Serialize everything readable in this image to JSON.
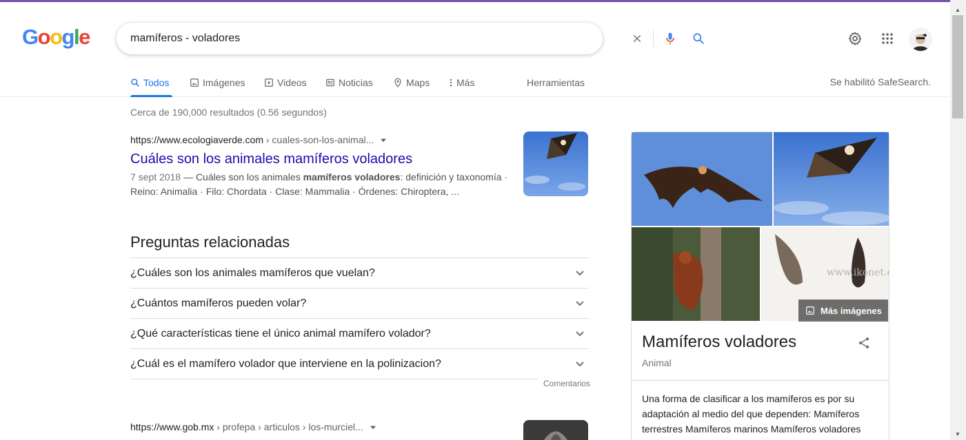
{
  "search": {
    "query": "mamíferos - voladores"
  },
  "logo": [
    "G",
    "o",
    "o",
    "g",
    "l",
    "e"
  ],
  "colors": {
    "logo": [
      "#4285f4",
      "#ea4335",
      "#fbbc05",
      "#4285f4",
      "#34a853",
      "#ea4335"
    ],
    "accent": "#1a73e8",
    "link": "#1a0dab"
  },
  "tabs": [
    {
      "label": "Todos",
      "icon": "search-icon"
    },
    {
      "label": "Imágenes",
      "icon": "image-icon"
    },
    {
      "label": "Videos",
      "icon": "play-icon"
    },
    {
      "label": "Noticias",
      "icon": "news-icon"
    },
    {
      "label": "Maps",
      "icon": "pin-icon"
    },
    {
      "label": "Más",
      "icon": "more-vert-icon"
    }
  ],
  "tools_label": "Herramientas",
  "safesearch": "Se habilitó SafeSearch.",
  "result_stats": "Cerca de 190,000 resultados (0.56 segundos)",
  "results": [
    {
      "domain": "https://www.ecologiaverde.com",
      "crumbs": " › cuales-son-los-animal...",
      "title": "Cuáles son los animales mamíferos voladores",
      "date": "7 sept 2018",
      "snippet_pre": " — Cuáles son los animales ",
      "snippet_bold": "mamíferos voladores",
      "snippet_post": ": definición y taxonomía · Reino: Animalia · Filo: Chordata · Clase: Mammalia · Órdenes: Chiroptera, ..."
    },
    {
      "domain": "https://www.gob.mx",
      "crumbs": " › profepa › articulos › los-murciel..."
    }
  ],
  "paa": {
    "title": "Preguntas relacionadas",
    "questions": [
      "¿Cuáles son los animales mamíferos que vuelan?",
      "¿Cuántos mamíferos pueden volar?",
      "¿Qué características tiene el único animal mamífero volador?",
      "¿Cuál es el mamífero volador que interviene en la polinizacion?"
    ],
    "feedback": "Comentarios"
  },
  "knowledge_panel": {
    "more_images": "Más imágenes",
    "watermark": "www.ikonet.com",
    "title": "Mamíferos voladores",
    "subtitle": "Animal",
    "description": "Una forma de clasificar a los mamíferos es por su adaptación al medio del que dependen: Mamíferos terrestres Mamíferos marinos Mamíferos voladores"
  }
}
